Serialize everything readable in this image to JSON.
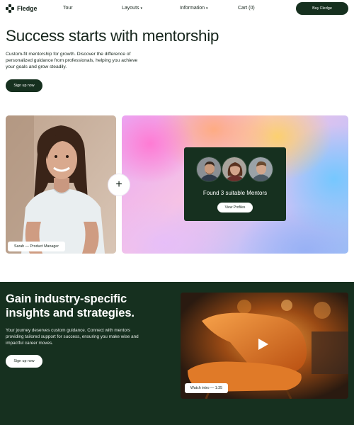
{
  "nav": {
    "logo_text": "Fledge",
    "logo_icon": "fledge-logo-icon",
    "items": [
      {
        "label": "Tour",
        "has_caret": false
      },
      {
        "label": "Layouts",
        "has_caret": true
      },
      {
        "label": "Information",
        "has_caret": true
      },
      {
        "label": "Cart (0)",
        "has_caret": false
      }
    ],
    "caret_glyph": "▾",
    "buy_label": "Buy Fledge"
  },
  "hero": {
    "title": "Success starts with mentorship",
    "subtitle": "Custom-fit mentorship for growth. Discover the difference of personalized guidance from professionals, helping you achieve your goals and grow steadily.",
    "signup_label": "Sign up now",
    "photo_tag": "Sarah — Product Manager",
    "plus_glyph": "+",
    "mentor_panel": {
      "text": "Found 3 suitable Mentors",
      "button_label": "View Profiles"
    }
  },
  "insights": {
    "title": "Gain industry-specific insights and strategies.",
    "subtitle": "Your journey deserves custom guidance. Connect with mentors providing tailored support for success, ensuring you make wise and impactful career moves.",
    "signup_label": "Sign up now",
    "video_tag": "Watch intro — 1:35",
    "play_icon": "play-icon"
  },
  "colors": {
    "brand_dark": "#16301f",
    "text": "#16251c",
    "white": "#ffffff"
  }
}
